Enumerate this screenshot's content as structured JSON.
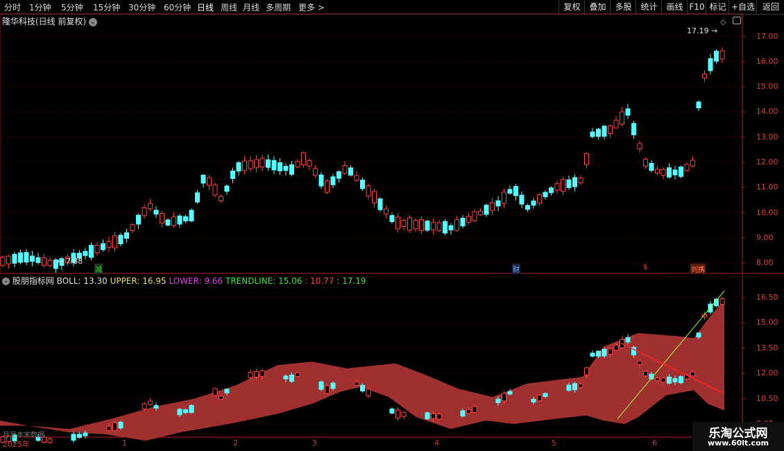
{
  "toolbar": {
    "periods": [
      "分时",
      "1分钟",
      "5分钟",
      "15分钟",
      "30分钟",
      "60分钟",
      "日线",
      "周线",
      "月线",
      "多周期",
      "更多 >"
    ],
    "active_period": "日线",
    "right_buttons": [
      "复权",
      "叠加",
      "多股",
      "统计",
      "画线",
      "F10",
      "标记",
      "+自选",
      "返回"
    ]
  },
  "main_panel": {
    "title": "隆华科技(日线 前复权)",
    "high_label": "17.19",
    "low_label": "7.88",
    "price_ticks": [
      "17.00",
      "16.00",
      "15.00",
      "14.00",
      "13.00",
      "12.00",
      "11.00",
      "10.00",
      "9.00",
      "8.00"
    ],
    "event_markers": [
      {
        "text": "减",
        "color": "#3fbf3f",
        "bg": "#1c3b1c"
      },
      {
        "text": "财",
        "color": "#6fa8ff",
        "bg": "#1c2540"
      },
      {
        "text": "$",
        "color": "#ff4040",
        "bg": "#000"
      },
      {
        "text": "刘携",
        "color": "#ff8050",
        "bg": "#5a1a10"
      }
    ]
  },
  "indicator_panel": {
    "name": "股朋指标网",
    "boll_label": "BOLL:",
    "boll": "13.30",
    "upper_label": "UPPER:",
    "upper": "16.95",
    "lower_label": "LOWER:",
    "lower": "9.66",
    "trend_label": "TRENDLINE:",
    "trend": "15.06",
    "v2": ": 10.77",
    "v3": ": 17.19",
    "ticks": [
      "16.50",
      "15.00",
      "13.50",
      "12.00",
      "10.50",
      "9.00"
    ]
  },
  "x_axis": {
    "labels": [
      "2025年",
      "1",
      "2",
      "3",
      "4",
      "5",
      "6"
    ],
    "note": "月至本末数据"
  },
  "watermark": {
    "line1": "乐淘公式网",
    "line2": "www.60lt.com"
  },
  "colors": {
    "up": "#ff4040",
    "down": "#54ffff",
    "band": "#a03030",
    "trend": "#9aff3c",
    "grid": "#5a1010"
  }
}
